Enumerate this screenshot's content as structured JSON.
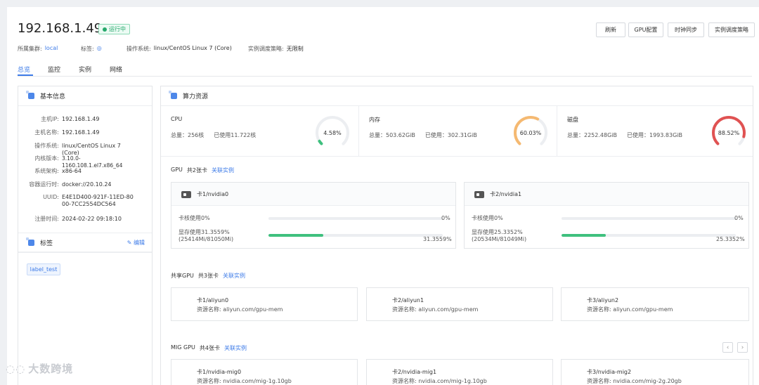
{
  "header": {
    "title": "192.168.1.49",
    "status": "运行中",
    "meta": [
      {
        "label": "所属集群:",
        "value": "local"
      },
      {
        "label": "标签:",
        "value": "◎"
      },
      {
        "label": "操作系统:",
        "value": "linux/CentOS Linux 7 (Core)"
      },
      {
        "label": "实例调度策略:",
        "value": "无限制"
      }
    ],
    "buttons": [
      "刷新",
      "GPU配置",
      "时钟同步",
      "实例调度策略"
    ]
  },
  "tabs": [
    "总览",
    "监控",
    "实例",
    "网络"
  ],
  "basic_info": {
    "title": "基本信息",
    "rows": [
      {
        "label": "主机IP:",
        "value": "192.168.1.49"
      },
      {
        "label": "主机名称:",
        "value": "192.168.1.49"
      },
      {
        "label": "操作系统:",
        "value": "linux/CentOS Linux 7 (Core)"
      },
      {
        "label": "内核版本:",
        "value": "3.10.0-1160.108.1.el7.x86_64"
      },
      {
        "label": "系统架构:",
        "value": "x86-64"
      },
      {
        "label": "容器运行时:",
        "value": "docker://20.10.24"
      },
      {
        "label": "UUID:",
        "value": "E4E1D400-921F-11ED-8000-7CC2554DC564"
      },
      {
        "label": "注册时间:",
        "value": "2024-02-22 09:18:10"
      }
    ]
  },
  "labels_panel": {
    "title": "标签",
    "edit": "编辑",
    "tags": [
      "label_test"
    ]
  },
  "compute": {
    "title": "算力资源",
    "metrics": [
      {
        "name": "CPU",
        "total": "总量：256核",
        "used": "已使用11.722核",
        "percent_text": "4.58%",
        "percent": 4.58,
        "color": "#3fc07e"
      },
      {
        "name": "内存",
        "total": "总量：503.62GiB",
        "used": "已使用：302.31GiB",
        "percent_text": "60.03%",
        "percent": 60.03,
        "color": "#f5b971"
      },
      {
        "name": "磁盘",
        "total": "总量：2252.48GiB",
        "used": "已使用：1993.83GiB",
        "percent_text": "88.52%",
        "percent": 88.52,
        "color": "#e05252"
      }
    ]
  },
  "gpu": {
    "label": "GPU",
    "count": "共2张卡",
    "link": "关联实例",
    "cards": [
      {
        "name": "卡1/nvidia0",
        "core_label": "卡核使用0%",
        "core_value": "0%",
        "core_fraction": 0,
        "mem_label": "显存使用31.3559%",
        "mem_detail": "(25414Mi/81050Mi)",
        "mem_value": "31.3559%",
        "mem_fraction": 0.313559
      },
      {
        "name": "卡2/nvidia1",
        "core_label": "卡核使用0%",
        "core_value": "0%",
        "core_fraction": 0,
        "mem_label": "显存使用25.3352%",
        "mem_detail": "(20534Mi/81049Mi)",
        "mem_value": "25.3352%",
        "mem_fraction": 0.253352
      }
    ]
  },
  "shared_gpu": {
    "label": "共享GPU",
    "count": "共3张卡",
    "link": "关联实例",
    "cards": [
      {
        "name": "卡1/aliyun0",
        "resource": "资源名称: aliyun.com/gpu-mem"
      },
      {
        "name": "卡2/aliyun1",
        "resource": "资源名称: aliyun.com/gpu-mem"
      },
      {
        "name": "卡3/aliyun2",
        "resource": "资源名称: aliyun.com/gpu-mem"
      }
    ]
  },
  "mig_gpu": {
    "label": "MIG GPU",
    "count": "共4张卡",
    "link": "关联实例",
    "pager_prev": "‹",
    "pager_next": "›",
    "cards": [
      {
        "name": "卡1/nvidia-mig0",
        "resource": "资源名称: nvidia.com/mig-1g.10gb"
      },
      {
        "name": "卡2/nvidia-mig1",
        "resource": "资源名称: nvidia.com/mig-1g.10gb"
      },
      {
        "name": "卡3/nvidia-mig2",
        "resource": "资源名称: nvidia.com/mig-2g.20gb"
      }
    ]
  },
  "watermark": "大数跨境"
}
